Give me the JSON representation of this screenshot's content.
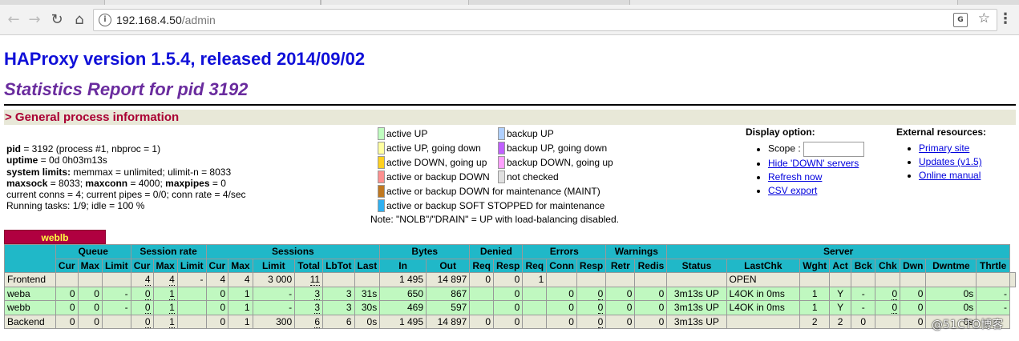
{
  "browser": {
    "url_host": "192.168.4.50",
    "url_path": "/admin"
  },
  "title": "HAProxy version 1.5.4, released 2014/09/02",
  "subtitle": "Statistics Report for pid 3192",
  "section": "> General process information",
  "process": [
    {
      "k": "pid",
      "v": " = 3192 (process #1, nbproc = 1)"
    },
    {
      "k": "uptime",
      "v": " = 0d 0h03m13s"
    },
    {
      "k": "system limits:",
      "v": " memmax = unlimited; ulimit-n = 8033"
    },
    {
      "k": "maxsock",
      "v": " = 8033; ",
      "k2": "maxconn",
      "v2": " = 4000; ",
      "k3": "maxpipes",
      "v3": " = 0"
    },
    {
      "k": "",
      "v": "current conns = 4; current pipes = 0/0; conn rate = 4/sec"
    },
    {
      "k": "",
      "v": "Running tasks: 1/9; idle = 100 %"
    }
  ],
  "legend": [
    {
      "color": "#c0ffc0",
      "label": "active UP"
    },
    {
      "color": "#ffffa0",
      "label": "active UP, going down"
    },
    {
      "color": "#ffd020",
      "label": "active DOWN, going up"
    },
    {
      "color": "#ff9090",
      "label": "active or backup DOWN"
    },
    {
      "color": "#c07820",
      "label": "active or backup DOWN for maintenance (MAINT)"
    },
    {
      "color": "#30b0f0",
      "label": "active or backup SOFT STOPPED for maintenance"
    },
    {
      "color": "#b0d0ff",
      "label": "backup UP"
    },
    {
      "color": "#c060ff",
      "label": "backup UP, going down"
    },
    {
      "color": "#ffa0ff",
      "label": "backup DOWN, going up"
    },
    {
      "color": "#e0e0e0",
      "label": "not checked"
    }
  ],
  "legend_note": "Note: \"NOLB\"/\"DRAIN\" = UP with load-balancing disabled.",
  "display": {
    "heading": "Display option:",
    "scope_label": "Scope :",
    "links": [
      "Hide 'DOWN' servers",
      "Refresh now",
      "CSV export"
    ]
  },
  "external": {
    "heading": "External resources:",
    "links": [
      "Primary site",
      "Updates (v1.5)",
      "Online manual"
    ]
  },
  "proxy_name": "weblb",
  "groups": [
    "Queue",
    "Session rate",
    "Sessions",
    "Bytes",
    "Denied",
    "Errors",
    "Warnings",
    "Server"
  ],
  "columns": [
    "Cur",
    "Max",
    "Limit",
    "Cur",
    "Max",
    "Limit",
    "Cur",
    "Max",
    "Limit",
    "Total",
    "LbTot",
    "Last",
    "In",
    "Out",
    "Req",
    "Resp",
    "Req",
    "Conn",
    "Resp",
    "Retr",
    "Redis",
    "Status",
    "LastChk",
    "Wght",
    "Act",
    "Bck",
    "Chk",
    "Dwn",
    "Dwntme",
    "Thrtle"
  ],
  "rows": [
    {
      "kind": "fe",
      "cells": [
        "Frontend",
        "",
        "",
        "",
        "4",
        "4",
        "-",
        "4",
        "4",
        "3 000",
        "11",
        "",
        "",
        "1 495",
        "14 897",
        "0",
        "0",
        "1",
        "",
        "",
        "",
        "",
        "",
        "OPEN",
        "",
        "",
        "",
        "",
        "",
        "",
        "",
        ""
      ]
    },
    {
      "kind": "sv",
      "cells": [
        "weba",
        "0",
        "0",
        "-",
        "0",
        "1",
        "",
        "0",
        "1",
        "-",
        "3",
        "3",
        "31s",
        "650",
        "867",
        "",
        "0",
        "",
        "0",
        "0",
        "0",
        "0",
        "3m13s UP",
        "L4OK in 0ms",
        "1",
        "Y",
        "-",
        "0",
        "0",
        "0s",
        "-"
      ]
    },
    {
      "kind": "sv",
      "cells": [
        "webb",
        "0",
        "0",
        "-",
        "0",
        "1",
        "",
        "0",
        "1",
        "-",
        "3",
        "3",
        "30s",
        "469",
        "597",
        "",
        "0",
        "",
        "0",
        "0",
        "0",
        "0",
        "3m13s UP",
        "L4OK in 0ms",
        "1",
        "Y",
        "-",
        "0",
        "0",
        "0s",
        "-"
      ]
    },
    {
      "kind": "be",
      "cells": [
        "Backend",
        "0",
        "0",
        "",
        "0",
        "1",
        "",
        "0",
        "1",
        "300",
        "6",
        "6",
        "0s",
        "1 495",
        "14 897",
        "0",
        "0",
        "",
        "0",
        "0",
        "0",
        "0",
        "3m13s UP",
        "",
        "2",
        "2",
        "0",
        "",
        "0",
        "0s",
        ""
      ]
    }
  ],
  "watermark": "@51CTO博客"
}
